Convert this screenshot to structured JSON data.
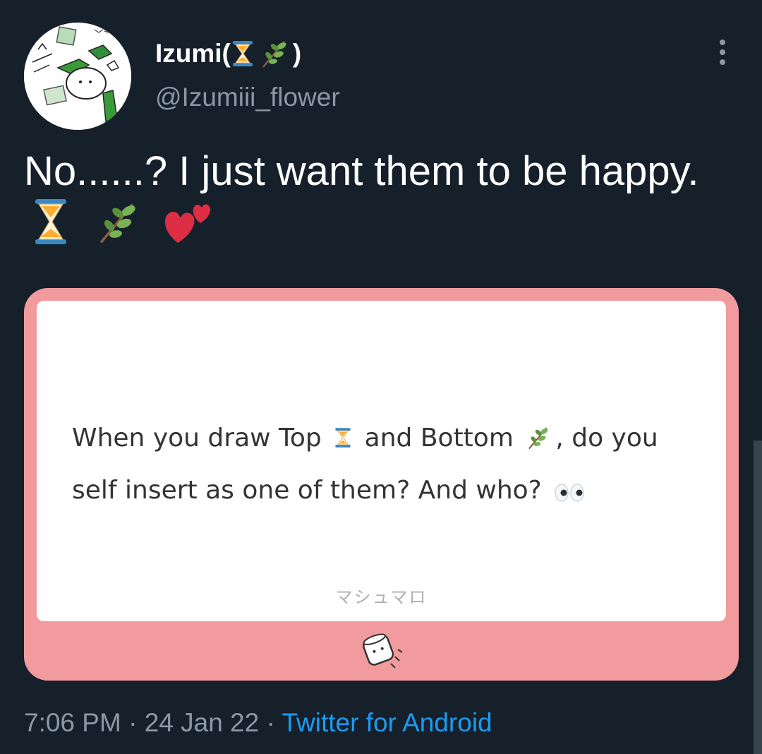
{
  "author": {
    "display_name": "Izumi(",
    "display_name_close": ")",
    "handle": "@Izumiii_flower"
  },
  "tweet": {
    "text": "No......? I just want them to be happy."
  },
  "card": {
    "question_part1": "When you draw Top",
    "question_part2": "and Bottom",
    "question_part3": ", do you self insert as one of them? And who?",
    "brand": "マシュマロ"
  },
  "meta": {
    "time": "7:06 PM",
    "separator1": " · ",
    "date": "24 Jan 22",
    "separator2": " · ",
    "source": "Twitter for Android"
  },
  "icons": {
    "avatar": "avatar-image",
    "more": "more-options-icon",
    "hourglass": "hourglass-icon",
    "herb": "herb-icon",
    "hearts": "two-hearts-icon",
    "eyes": "eyes-icon",
    "marshmallow": "marshmallow-icon"
  },
  "colors": {
    "background": "#15202b",
    "card_border": "#f19b9e",
    "link": "#1d9bf0",
    "muted": "#8b98a5"
  }
}
